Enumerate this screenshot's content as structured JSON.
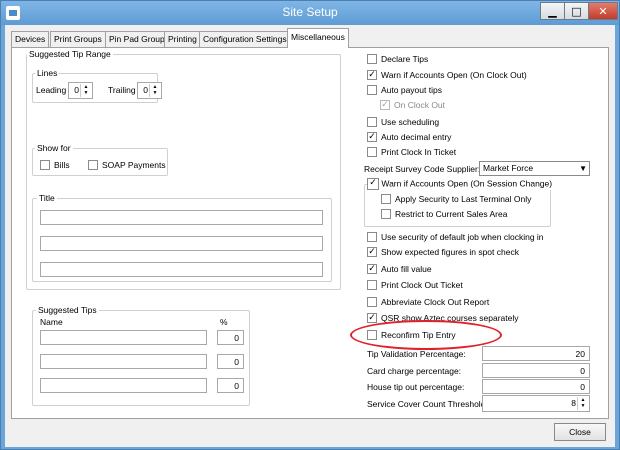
{
  "window": {
    "title": "Site Setup",
    "min_icon": "minimize-icon",
    "max_icon": "maximize-icon",
    "close_glyph": "✕"
  },
  "tabs": [
    "Devices",
    "Print Groups",
    "Pin Pad Groups",
    "Printing",
    "Configuration Settings",
    "Miscellaneous"
  ],
  "active_tab": "Miscellaneous",
  "suggested_tip_range": {
    "label": "Suggested Tip Range",
    "lines": {
      "label": "Lines",
      "leading_label": "Leading",
      "leading_value": "0",
      "trailing_label": "Trailing",
      "trailing_value": "0"
    },
    "show_for": {
      "label": "Show for",
      "bills_label": "Bills",
      "soap_label": "SOAP Payments"
    },
    "title_group": {
      "label": "Title"
    }
  },
  "suggested_tips": {
    "label": "Suggested Tips",
    "name_header": "Name",
    "percent_header": "%",
    "rows": [
      {
        "name": "",
        "percent": "0"
      },
      {
        "name": "",
        "percent": "0"
      },
      {
        "name": "",
        "percent": "0"
      }
    ]
  },
  "options": [
    {
      "label": "Declare Tips",
      "checked": false
    },
    {
      "label": "Warn if Accounts Open (On Clock Out)",
      "checked": true
    },
    {
      "label": "Auto payout tips",
      "checked": false
    },
    {
      "label": "On Clock Out",
      "checked": true,
      "disabled": true
    },
    {
      "label": "Use scheduling",
      "checked": false
    },
    {
      "label": "Auto decimal entry",
      "checked": true
    },
    {
      "label": "Print Clock In Ticket",
      "checked": false
    }
  ],
  "receipt_survey": {
    "label": "Receipt Survey Code Supplier:",
    "value": "Market Force"
  },
  "warn_session": {
    "label": "Warn if Accounts Open (On Session Change)",
    "checked": true,
    "apply_label": "Apply Security to Last Terminal Only",
    "restrict_label": "Restrict to Current Sales Area"
  },
  "options2": [
    {
      "label": "Use security of default job when clocking in",
      "checked": false
    },
    {
      "label": "Show expected figures in spot check",
      "checked": true
    },
    {
      "label": "Auto fill value",
      "checked": true
    },
    {
      "label": "Print Clock Out Ticket",
      "checked": false
    },
    {
      "label": "Abbreviate Clock Out Report",
      "checked": false
    },
    {
      "label": "QSR show Aztec courses separately",
      "checked": true
    },
    {
      "label": "Reconfirm Tip Entry",
      "checked": false
    }
  ],
  "fields": [
    {
      "label": "Tip Validation Percentage:",
      "value": "20"
    },
    {
      "label": "Card charge percentage:",
      "value": "0"
    },
    {
      "label": "House tip out percentage:",
      "value": "0"
    },
    {
      "label": "Service Cover Count Threshold:",
      "value": "8"
    }
  ],
  "close_label": "Close",
  "colors": {
    "title_bar": "#6aa6dc",
    "highlight_circle": "#e0202a"
  }
}
